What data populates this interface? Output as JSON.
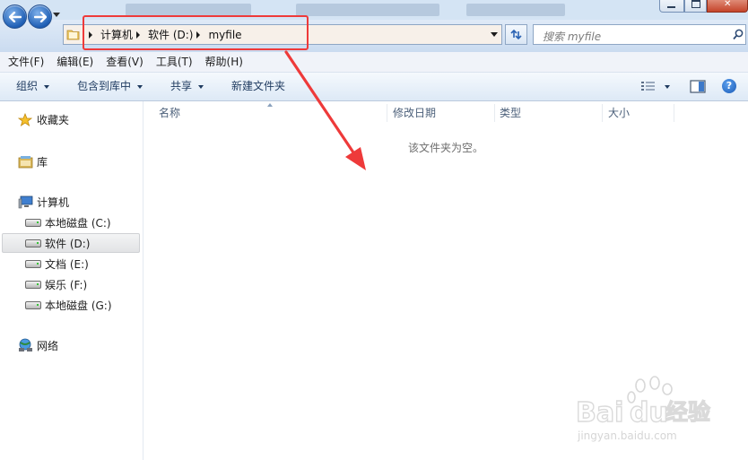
{
  "window": {
    "controls": {
      "minimize": "—",
      "maximize": "□",
      "close": "✕"
    }
  },
  "address": {
    "crumbs": [
      "计算机",
      "软件 (D:)",
      "myfile"
    ]
  },
  "search": {
    "placeholder": "搜索 myfile"
  },
  "menu": [
    "文件(F)",
    "编辑(E)",
    "查看(V)",
    "工具(T)",
    "帮助(H)"
  ],
  "toolbar": {
    "organize": "组织",
    "include_in_library": "包含到库中",
    "share": "共享",
    "new_folder": "新建文件夹"
  },
  "nav": {
    "favorites": "收藏夹",
    "libraries": "库",
    "computer": "计算机",
    "drives": [
      "本地磁盘 (C:)",
      "软件 (D:)",
      "文档 (E:)",
      "娱乐 (F:)",
      "本地磁盘 (G:)"
    ],
    "selected_drive": "软件 (D:)",
    "network": "网络"
  },
  "columns": [
    "名称",
    "修改日期",
    "类型",
    "大小"
  ],
  "content": {
    "empty_message": "该文件夹为空。"
  },
  "watermark": {
    "brand_a": "Bai",
    "brand_b": "du",
    "brand_cn": "经验",
    "url": "jingyan.baidu.com"
  },
  "colors": {
    "annotation_red": "#ee3a3a",
    "nav_bg": "#dfeaf7",
    "toolbar_text": "#1e3a5f"
  },
  "icons": {
    "back": "arrow-left-icon",
    "forward": "arrow-right-icon",
    "folder": "folder-icon",
    "refresh": "refresh-icon",
    "search": "search-icon",
    "views": "view-options-icon",
    "preview_pane": "preview-pane-icon",
    "help": "help-icon",
    "favorites": "star-icon",
    "libraries": "library-icon",
    "computer": "computer-icon",
    "drive": "drive-icon",
    "network": "network-icon"
  }
}
